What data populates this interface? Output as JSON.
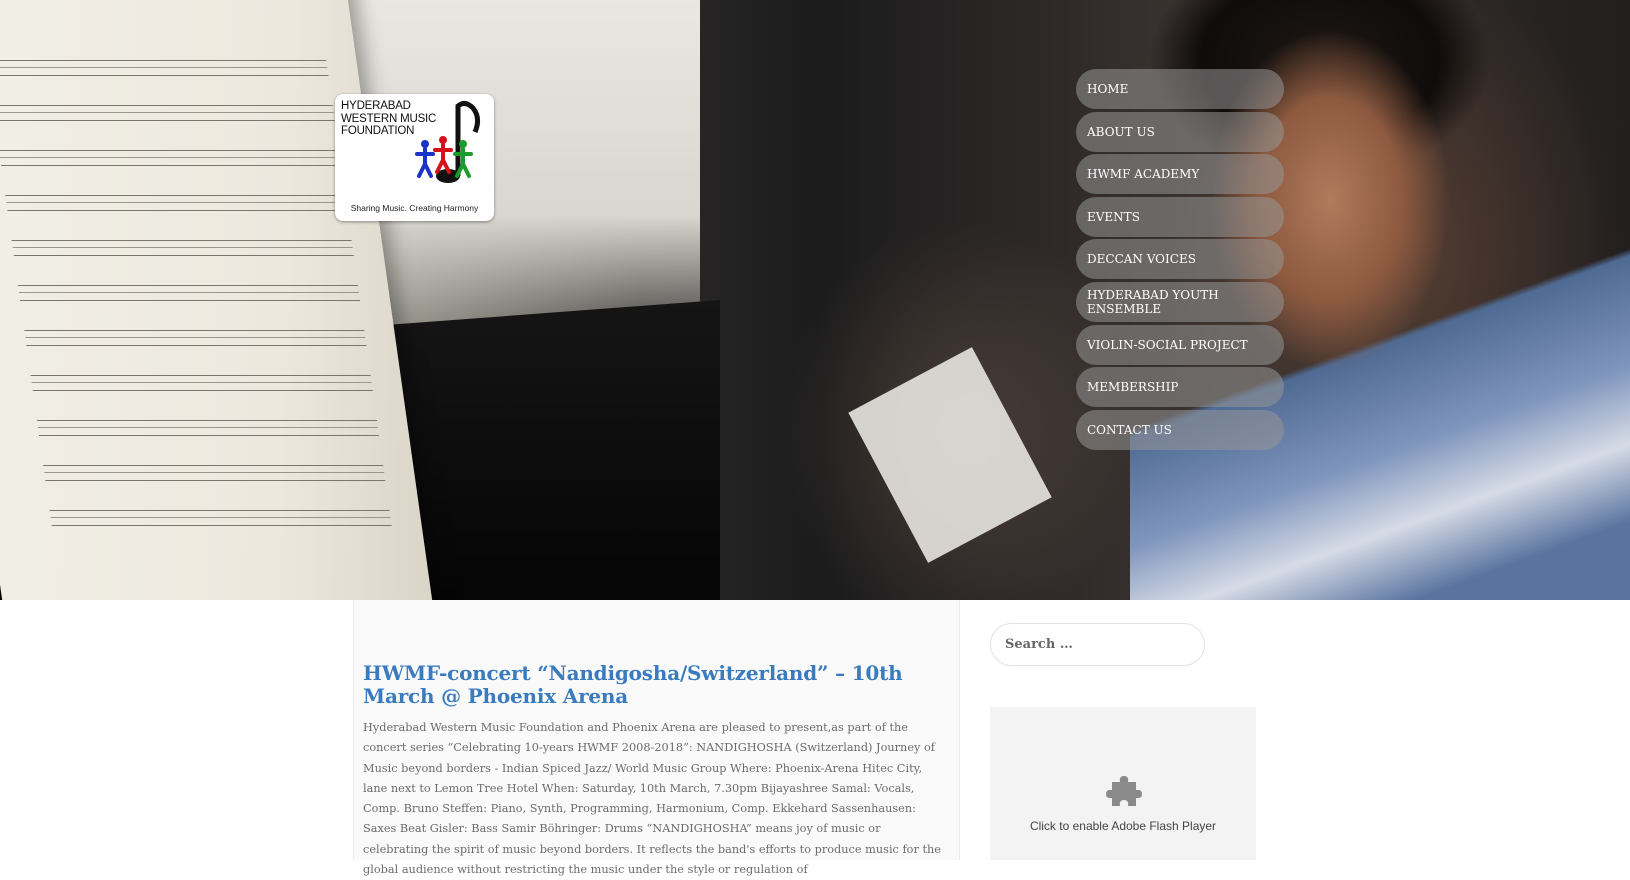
{
  "logo": {
    "line1": "HYDERABAD",
    "line2": "WESTERN MUSIC",
    "line3": "FOUNDATION",
    "tagline": "Sharing Music. Creating Harmony"
  },
  "nav": {
    "items": [
      {
        "label": "HOME"
      },
      {
        "label": "ABOUT US"
      },
      {
        "label": "HWMF ACADEMY"
      },
      {
        "label": "EVENTS"
      },
      {
        "label": "DECCAN VOICES"
      },
      {
        "label": "HYDERABAD YOUTH ENSEMBLE"
      },
      {
        "label": "VIOLIN-SOCIAL PROJECT"
      },
      {
        "label": "MEMBERSHIP"
      },
      {
        "label": "CONTACT US"
      }
    ]
  },
  "post": {
    "title": "HWMF-concert “Nandigosha/Switzerland” – 10th March @ Phoenix Arena",
    "body": "Hyderabad Western Music Foundation and Phoenix Arena are pleased to present,as part of the concert series “Celebrating 10-years HWMF 2008-2018”: NANDIGHOSHA (Switzerland) Journey of Music beyond borders - Indian Spiced Jazz/ World Music Group Where: Phoenix-Arena Hitec City, lane next to Lemon Tree Hotel When: Saturday, 10th March, 7.30pm   Bijayashree Samal: Vocals, Comp. Bruno Steffen: Piano, Synth, Programming, Harmonium, Comp. Ekkehard Sassenhausen: Saxes Beat Gisler: Bass Samir Böhringer: Drums  “NANDIGHOSHA” means joy of music or celebrating the spirit of music beyond borders. It reflects the band's efforts to produce music for the global audience without restricting the music under the style or regulation of"
  },
  "sidebar": {
    "search_placeholder": "Search …",
    "flash_text": "Click to enable Adobe Flash Player",
    "flash_icon": "puzzle-piece-icon"
  },
  "colors": {
    "title": "#3a7bbf",
    "nav_pill": "rgba(150,150,150,0.55)",
    "body_text": "#6b6b6b"
  }
}
